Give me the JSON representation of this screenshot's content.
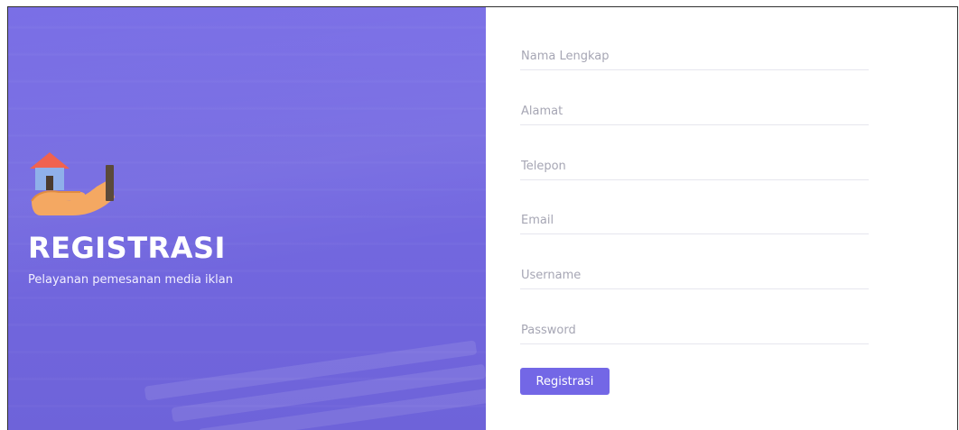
{
  "hero": {
    "title": "REGISTRASI",
    "subtitle": "Pelayanan pemesanan media iklan",
    "icon": "house-in-hand-icon"
  },
  "form": {
    "fields": [
      {
        "name": "nama",
        "placeholder": "Nama Lengkap",
        "value": ""
      },
      {
        "name": "alamat",
        "placeholder": "Alamat",
        "value": ""
      },
      {
        "name": "telepon",
        "placeholder": "Telepon",
        "value": ""
      },
      {
        "name": "email",
        "placeholder": "Email",
        "value": ""
      },
      {
        "name": "username",
        "placeholder": "Username",
        "value": ""
      },
      {
        "name": "password",
        "placeholder": "Password",
        "value": ""
      }
    ],
    "submit_label": "Registrasi"
  },
  "colors": {
    "accent": "#7367e6",
    "hero_bg": "#7368e0",
    "field_border": "#e6e6ee",
    "placeholder": "#a6a6b4"
  }
}
